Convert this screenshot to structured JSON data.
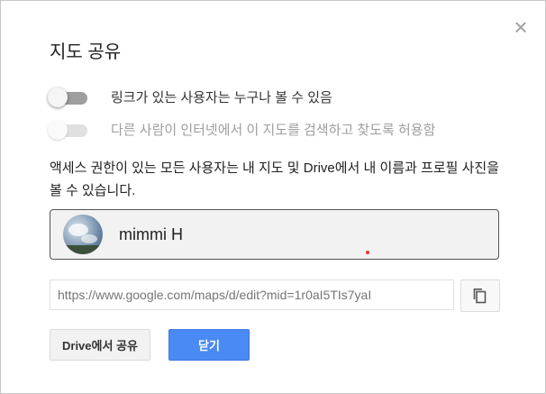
{
  "dialog": {
    "title": "지도 공유",
    "close_symbol": "×",
    "toggles": [
      {
        "label": "링크가 있는 사용자는 누구나 볼 수 있음",
        "enabled": true,
        "on": false
      },
      {
        "label": "다른 사람이 인터넷에서 이 지도를 검색하고 찾도록 허용함",
        "enabled": false,
        "on": false
      }
    ],
    "info_text": "액세스 권한이 있는 모든 사용자는 내 지도 및 Drive에서 내 이름과 프로필 사진을 볼 수 있습니다.",
    "user": {
      "name": "mimmi H",
      "avatar_icon": "profile-photo"
    },
    "share_link": {
      "value": "https://www.google.com/maps/d/edit?mid=1r0aI5TIs7yaI"
    },
    "buttons": {
      "drive_share": "Drive에서 공유",
      "close": "닫기"
    },
    "colors": {
      "primary": "#4a8af4",
      "toggle_off": "#9e9e9e",
      "border": "#c6c6c6"
    }
  }
}
